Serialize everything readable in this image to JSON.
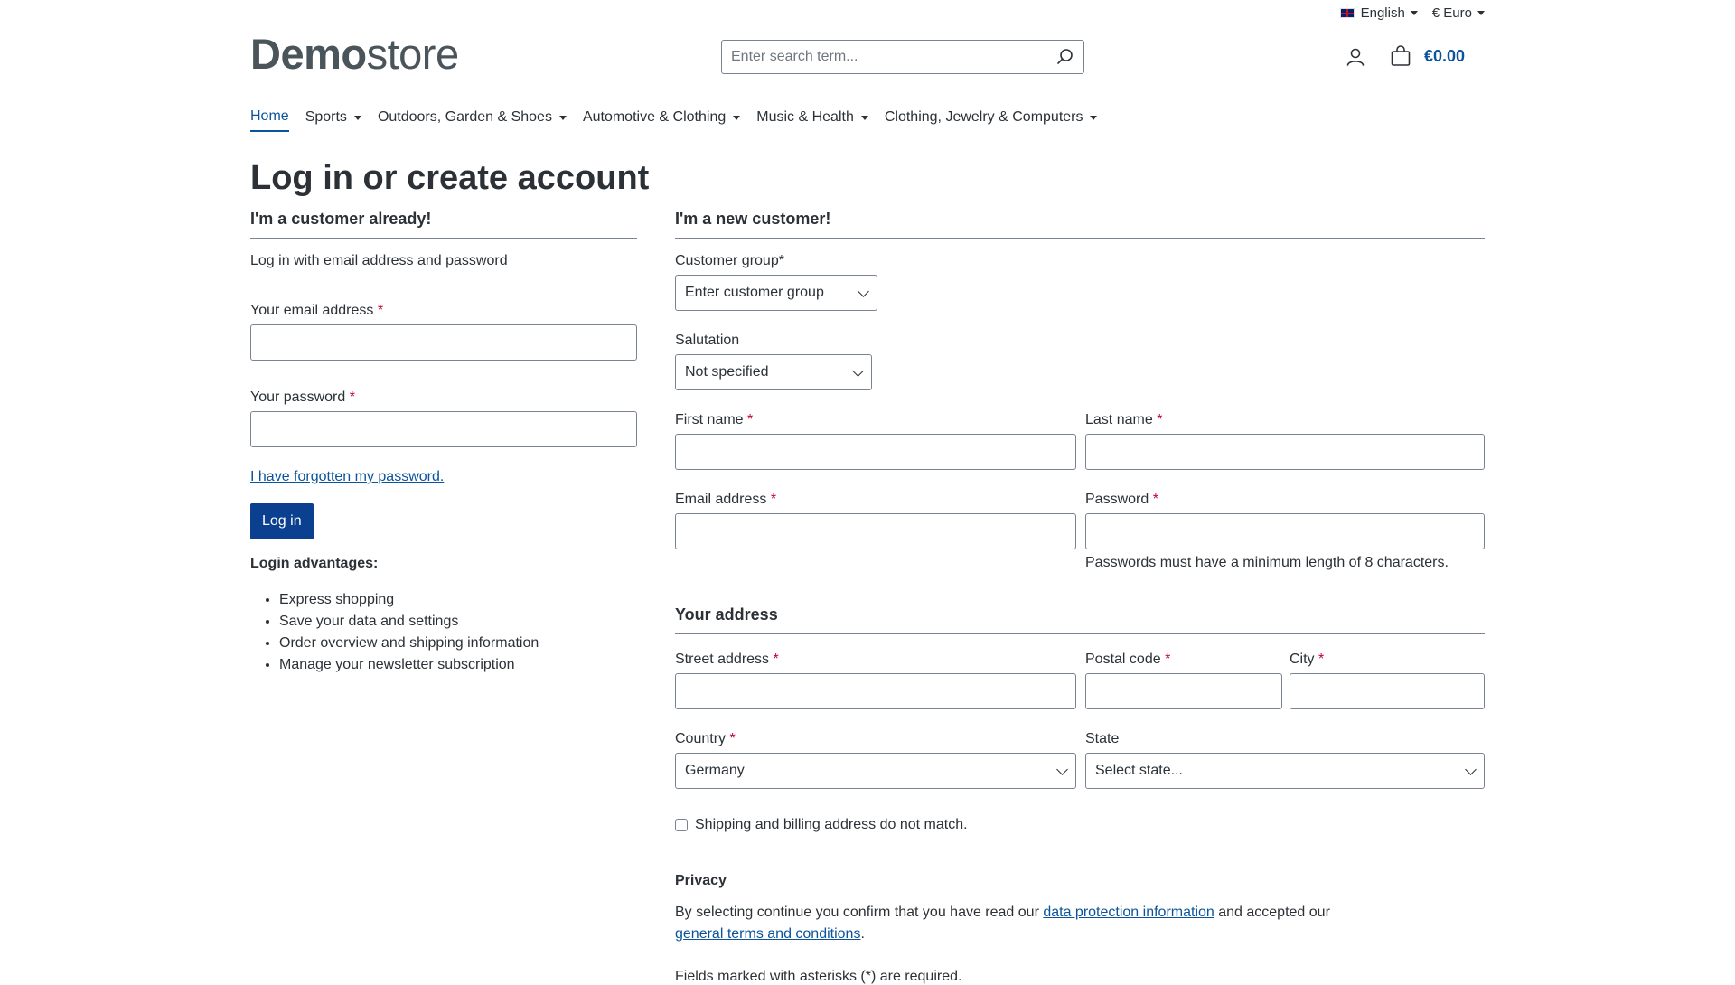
{
  "topbar": {
    "language": "English",
    "currency": "€ Euro"
  },
  "header": {
    "logo_bold": "Demo",
    "logo_light": "store",
    "search_placeholder": "Enter search term...",
    "cart_total": "€0.00"
  },
  "nav": {
    "items": [
      {
        "label": "Home"
      },
      {
        "label": "Sports"
      },
      {
        "label": "Outdoors, Garden & Shoes"
      },
      {
        "label": "Automotive & Clothing"
      },
      {
        "label": "Music & Health"
      },
      {
        "label": "Clothing, Jewelry & Computers"
      }
    ]
  },
  "page_title": "Log in or create account",
  "login": {
    "title": "I'm a customer already!",
    "intro": "Log in with email address and password",
    "email_label": "Your email address",
    "password_label": "Your password",
    "forgot_link": "I have forgotten my password.",
    "login_button": "Log in",
    "advantages_title": "Login advantages:",
    "advantages": [
      "Express shopping",
      "Save your data and settings",
      "Order overview and shipping information",
      "Manage your newsletter subscription"
    ]
  },
  "register": {
    "title": "I'm a new customer!",
    "customer_group_label": "Customer group*",
    "customer_group_value": "Enter customer group",
    "salutation_label": "Salutation",
    "salutation_value": "Not specified",
    "first_name_label": "First name",
    "last_name_label": "Last name",
    "email_label": "Email address",
    "password_label": "Password",
    "password_hint": "Passwords must have a minimum length of 8 characters.",
    "address_title": "Your address",
    "street_label": "Street address",
    "postal_label": "Postal code",
    "city_label": "City",
    "country_label": "Country",
    "country_value": "Germany",
    "state_label": "State",
    "state_value": "Select state...",
    "shipping_checkbox_label": "Shipping and billing address do not match.",
    "privacy_title": "Privacy",
    "privacy_text_1": "By selecting continue you confirm that you have read our ",
    "privacy_link_1": "data protection information",
    "privacy_text_2": " and accepted our",
    "privacy_link_2": "general terms and conditions",
    "privacy_text_3": ".",
    "required_note": "Fields marked with asterisks (*) are required."
  },
  "required_mark": "*"
}
